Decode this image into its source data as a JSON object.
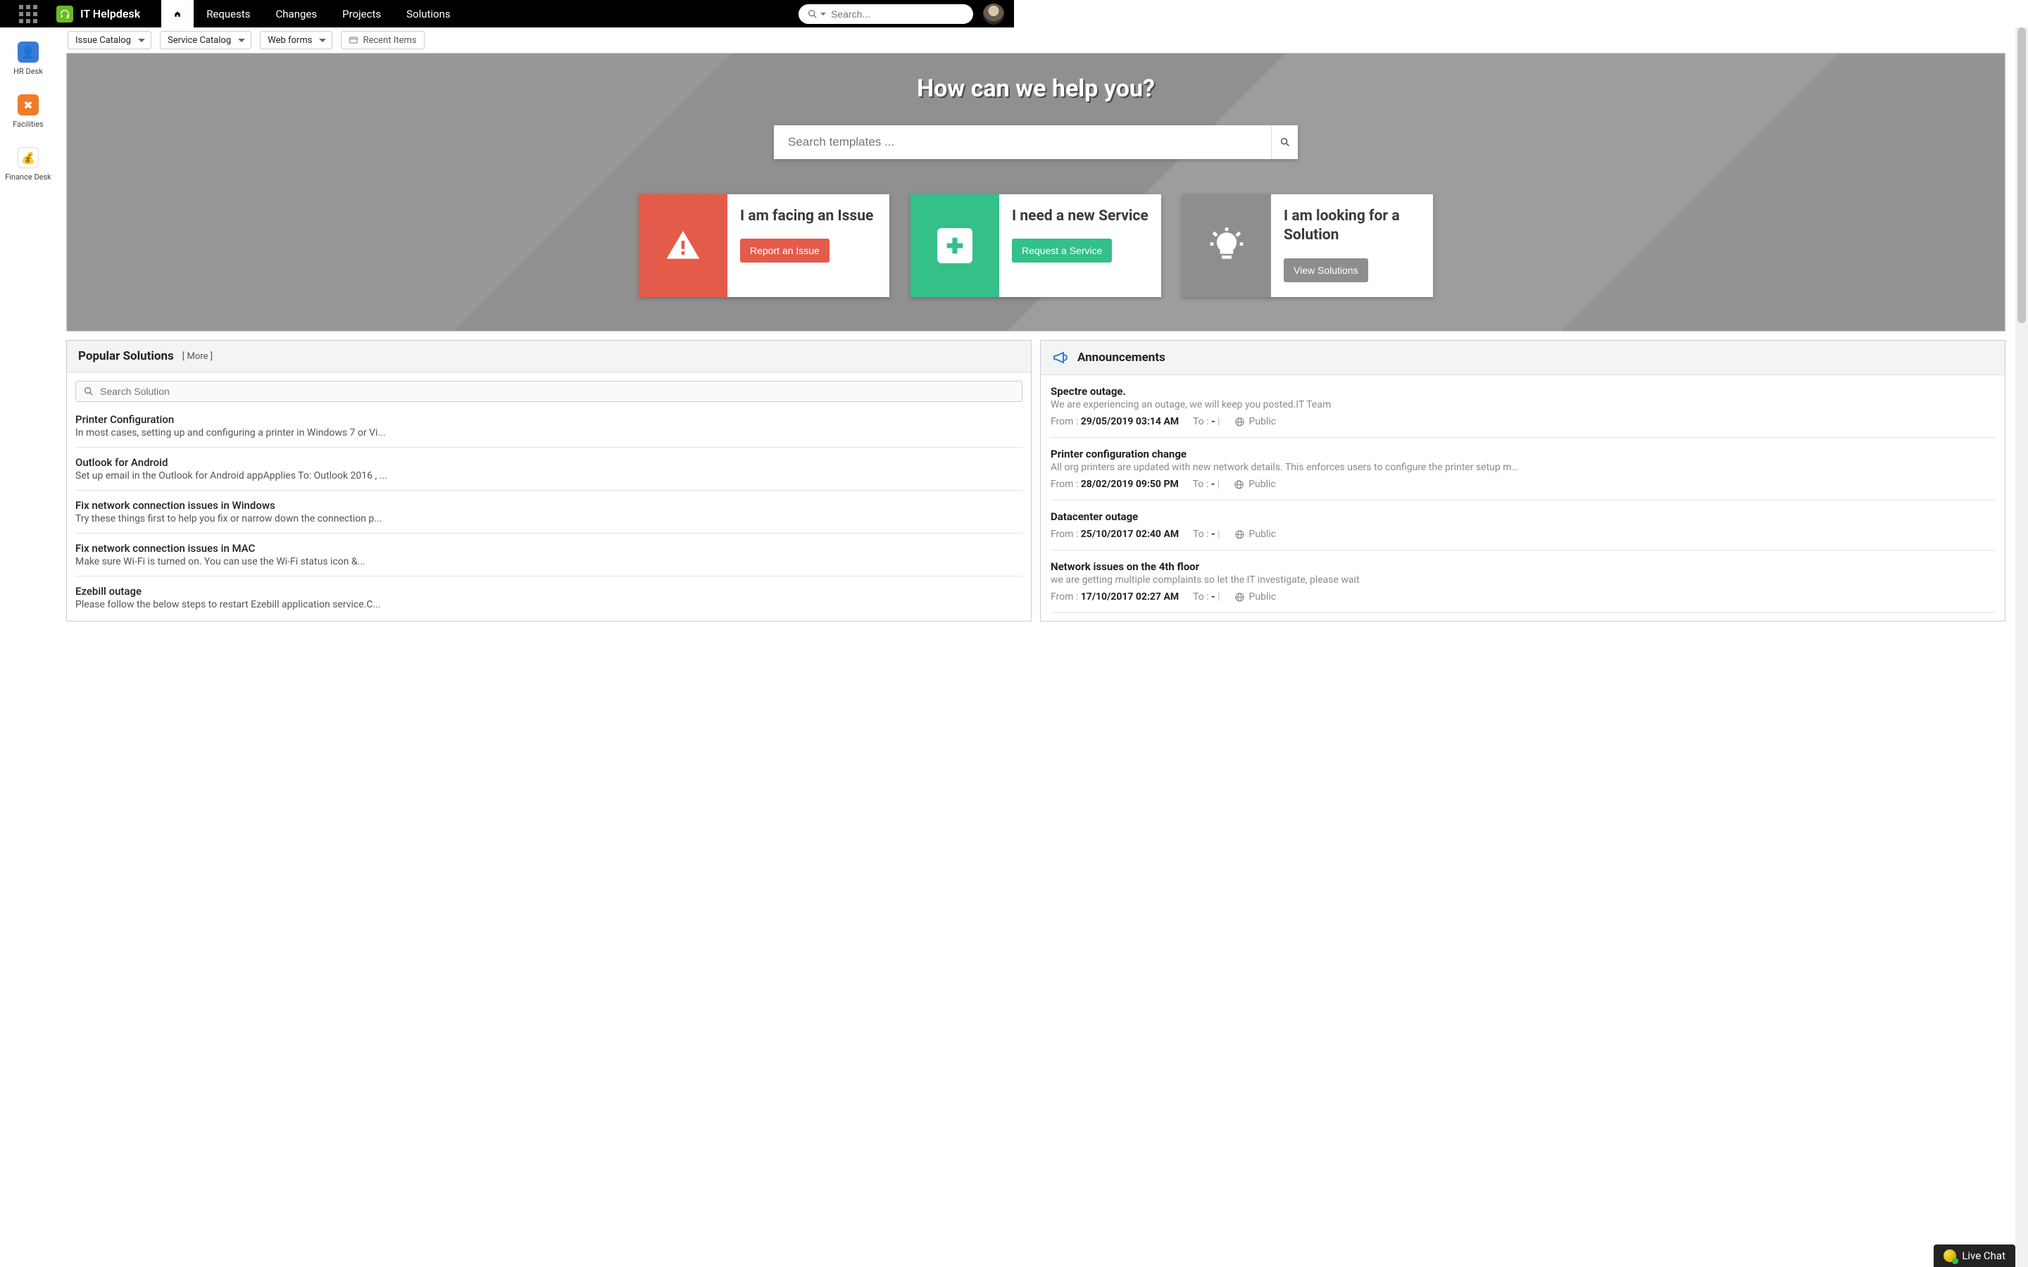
{
  "header": {
    "app_title": "IT Helpdesk",
    "search_placeholder": "Search...",
    "nav": [
      "Requests",
      "Changes",
      "Projects",
      "Solutions"
    ]
  },
  "leftrail": [
    {
      "label": "HR Desk",
      "icon": "hr"
    },
    {
      "label": "Facilities",
      "icon": "fac"
    },
    {
      "label": "Finance Desk",
      "icon": "fin"
    }
  ],
  "subbar": {
    "issue_catalog": "Issue Catalog",
    "service_catalog": "Service Catalog",
    "web_forms": "Web forms",
    "recent_items": "Recent Items"
  },
  "hero": {
    "title": "How can we help you?",
    "search_placeholder": "Search templates ...",
    "cards": [
      {
        "title": "I am facing an Issue",
        "button": "Report an Issue"
      },
      {
        "title": "I need a new Service",
        "button": "Request a Service"
      },
      {
        "title": "I am looking for a Solution",
        "button": "View Solutions"
      }
    ]
  },
  "solutions": {
    "heading": "Popular Solutions",
    "more": "[ More ]",
    "search_placeholder": "Search Solution",
    "items": [
      {
        "title": "Printer Configuration",
        "desc": "In most cases, setting up and configuring a printer in Windows 7 or Vi..."
      },
      {
        "title": "Outlook for Android",
        "desc": "Set up email in the Outlook for Android appApplies To: Outlook 2016 , ..."
      },
      {
        "title": "Fix network connection issues in Windows",
        "desc": "Try these things first to help you fix or narrow down the connection p..."
      },
      {
        "title": "Fix network connection issues in MAC",
        "desc": "Make sure Wi-Fi is turned on. You can use the Wi-Fi status icon &..."
      },
      {
        "title": "Ezebill outage",
        "desc": "Please follow the below steps to restart Ezebill application service.C..."
      }
    ]
  },
  "announcements": {
    "heading": "Announcements",
    "from_label": "From :",
    "to_label": "To :",
    "to_value": "-",
    "visibility": "Public",
    "items": [
      {
        "title": "Spectre outage.",
        "desc": "We are experiencing an outage, we will keep you posted.IT Team",
        "from": "29/05/2019 03:14 AM"
      },
      {
        "title": "Printer configuration change",
        "desc": "All org printers are updated with new network details. This enforces users to configure the printer setup m…",
        "from": "28/02/2019 09:50 PM"
      },
      {
        "title": "Datacenter outage",
        "desc": "",
        "from": "25/10/2017 02:40 AM"
      },
      {
        "title": "Network issues on the 4th floor",
        "desc": "we are getting multiple complaints so let the IT investigate, please wait",
        "from": "17/10/2017 02:27 AM"
      }
    ]
  },
  "livechat": "Live Chat"
}
